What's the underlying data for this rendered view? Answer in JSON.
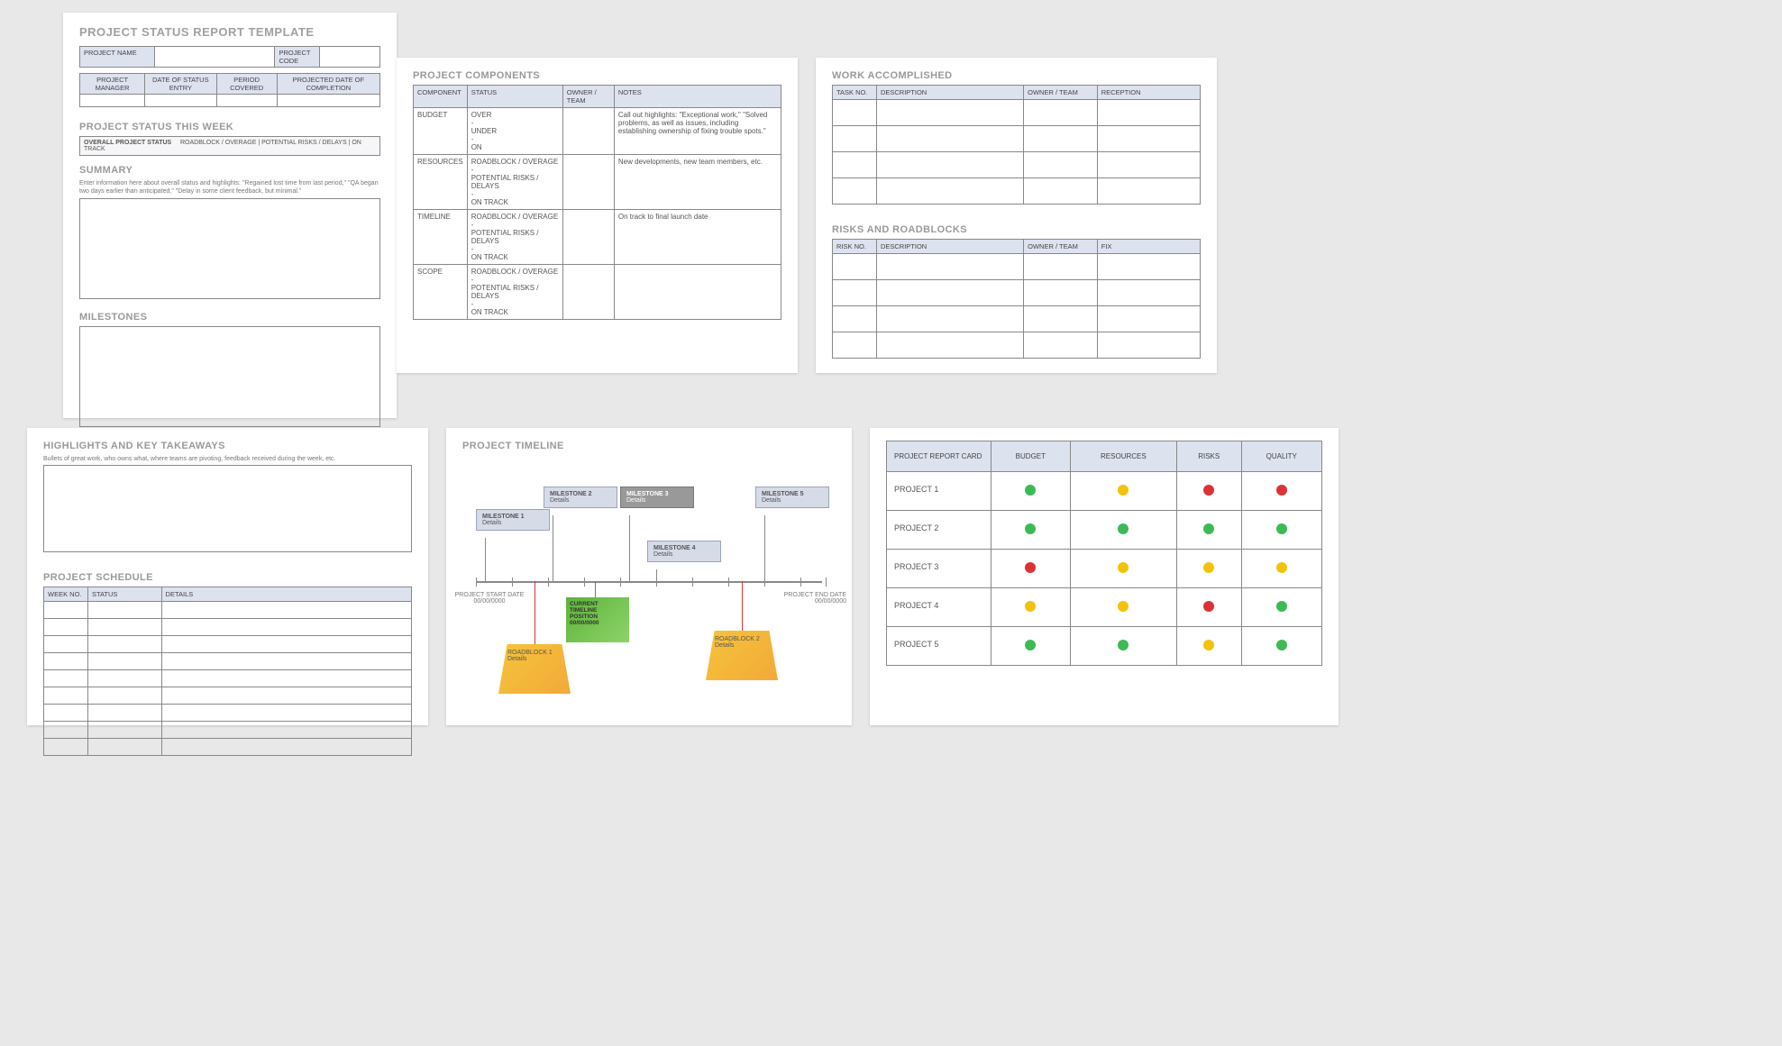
{
  "p1": {
    "title": "PROJECT STATUS REPORT TEMPLATE",
    "hdr1": {
      "name": "PROJECT NAME",
      "code": "PROJECT CODE"
    },
    "hdr2": {
      "pm": "PROJECT MANAGER",
      "de": "DATE OF STATUS ENTRY",
      "pc": "PERIOD COVERED",
      "pd": "PROJECTED DATE OF COMPLETION"
    },
    "statusWeek": "PROJECT STATUS THIS WEEK",
    "statusLineLabel": "OVERALL PROJECT STATUS",
    "statusLine": "ROADBLOCK / OVERAGE   |   POTENTIAL RISKS / DELAYS   |   ON TRACK",
    "summary": "SUMMARY",
    "summaryHint": "Enter information here about overall status and highlights: \"Regained lost time from last period,\" \"QA began two days earlier than anticipated,\" \"Delay in some client feedback, but minimal.\"",
    "milestones": "MILESTONES"
  },
  "p2": {
    "title": "PROJECT COMPONENTS",
    "cols": {
      "c1": "COMPONENT",
      "c2": "STATUS",
      "c3": "OWNER / TEAM",
      "c4": "NOTES"
    },
    "rows": [
      {
        "c": "BUDGET",
        "s": "OVER\n-\nUNDER\n-\nON",
        "n": "Call out highlights: \"Exceptional work,\" \"Solved problems, as well as issues, including establishing ownership of fixing trouble spots.\""
      },
      {
        "c": "RESOURCES",
        "s": "ROADBLOCK / OVERAGE\n-\nPOTENTIAL RISKS / DELAYS\n-\nON TRACK",
        "n": "New developments, new team members, etc."
      },
      {
        "c": "TIMELINE",
        "s": "ROADBLOCK / OVERAGE\n-\nPOTENTIAL RISKS / DELAYS\n-\nON TRACK",
        "n": "On track to final launch date"
      },
      {
        "c": "SCOPE",
        "s": "ROADBLOCK / OVERAGE\n-\nPOTENTIAL RISKS / DELAYS\n-\nON TRACK",
        "n": ""
      }
    ]
  },
  "p3": {
    "workTitle": "WORK ACCOMPLISHED",
    "workCols": {
      "c1": "TASK NO.",
      "c2": "DESCRIPTION",
      "c3": "OWNER / TEAM",
      "c4": "RECEPTION"
    },
    "riskTitle": "RISKS AND ROADBLOCKS",
    "riskCols": {
      "c1": "RISK NO.",
      "c2": "DESCRIPTION",
      "c3": "OWNER / TEAM",
      "c4": "FIX"
    }
  },
  "p4": {
    "title": "HIGHLIGHTS AND KEY TAKEAWAYS",
    "hint": "Bullets of great work, who owns what, where teams are pivoting, feedback received during the week, etc.",
    "schedTitle": "PROJECT SCHEDULE",
    "schedCols": {
      "c1": "WEEK NO.",
      "c2": "STATUS",
      "c3": "DETAILS"
    }
  },
  "p5": {
    "title": "PROJECT TIMELINE",
    "ms": [
      {
        "t": "MILESTONE 1",
        "d": "Details"
      },
      {
        "t": "MILESTONE 2",
        "d": "Details"
      },
      {
        "t": "MILESTONE 3",
        "d": "Details"
      },
      {
        "t": "MILESTONE 4",
        "d": "Details"
      },
      {
        "t": "MILESTONE 5",
        "d": "Details"
      }
    ],
    "start": {
      "l": "PROJECT START DATE",
      "d": "00/00/0000"
    },
    "end": {
      "l": "PROJECT END DATE",
      "d": "00/00/0000"
    },
    "current": "CURRENT TIMELINE POSITION 00/00/0000",
    "rb1": {
      "t": "ROADBLOCK 1",
      "d": "Details"
    },
    "rb2": {
      "t": "ROADBLOCK 2",
      "d": "Details"
    }
  },
  "p6": {
    "cols": {
      "c1": "PROJECT REPORT CARD",
      "c2": "BUDGET",
      "c3": "RESOURCES",
      "c4": "RISKS",
      "c5": "QUALITY"
    },
    "rows": [
      {
        "name": "PROJECT 1",
        "v": [
          "g",
          "y",
          "r",
          "r"
        ]
      },
      {
        "name": "PROJECT 2",
        "v": [
          "g",
          "g",
          "g",
          "g"
        ]
      },
      {
        "name": "PROJECT 3",
        "v": [
          "r",
          "y",
          "y",
          "y"
        ]
      },
      {
        "name": "PROJECT 4",
        "v": [
          "y",
          "y",
          "r",
          "g"
        ]
      },
      {
        "name": "PROJECT 5",
        "v": [
          "g",
          "g",
          "y",
          "g"
        ]
      }
    ]
  }
}
